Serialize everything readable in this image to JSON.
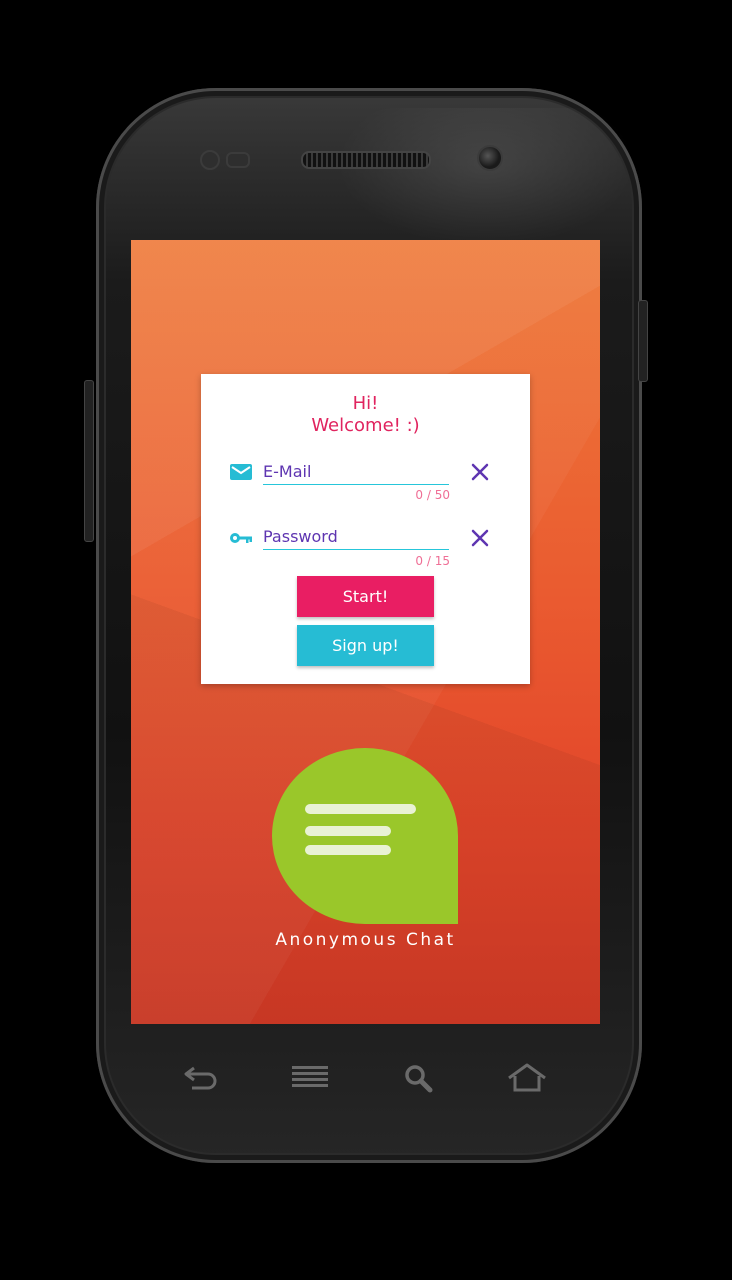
{
  "login_card": {
    "greeting_line1": "Hi!",
    "greeting_line2": "Welcome! :)",
    "email": {
      "placeholder": "E-Mail",
      "counter": "0 / 50",
      "icon": "email-icon",
      "value": ""
    },
    "password": {
      "placeholder": "Password",
      "counter": "0 / 15",
      "icon": "key-icon",
      "value": ""
    },
    "start_label": "Start!",
    "signup_label": "Sign up!"
  },
  "app": {
    "name": "Anonymous Chat",
    "logo_icon": "chat-bubble-icon"
  },
  "hardware_keys": [
    "back-icon",
    "menu-icon",
    "search-icon",
    "home-icon"
  ],
  "colors": {
    "accent_pink": "#e91e63",
    "accent_cyan": "#26bcd4",
    "text_purple": "#5e35b1",
    "logo_green": "#9ac72a",
    "background_orange": "#e95430"
  }
}
